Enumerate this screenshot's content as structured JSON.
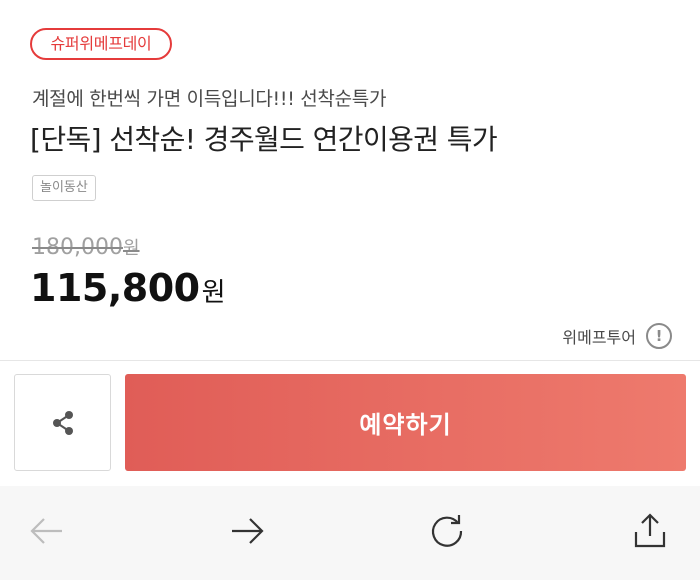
{
  "promo": {
    "badge": "슈퍼위메프데이"
  },
  "product": {
    "subtitle": "계절에 한번씩 가면 이득입니다!!! 선착순특가",
    "title": "[단독] 선착순! 경주월드 연간이용권 특가",
    "tag": "놀이동산",
    "original_price": "180,000",
    "original_unit": "원",
    "sale_price": "115,800",
    "sale_unit": "원",
    "seller": "위메프투어",
    "info_icon_text": "!"
  },
  "actions": {
    "share_icon": "share-icon",
    "reserve_label": "예약하기"
  },
  "browser": {
    "back_icon": "arrow-left-icon",
    "forward_icon": "arrow-right-icon",
    "reload_icon": "reload-icon",
    "share_icon": "upload-share-icon",
    "back_enabled": false
  },
  "colors": {
    "accent": "#e53b3b",
    "button_start": "#e05d57",
    "button_end": "#ee7a6d",
    "browser_bar": "#f7f7f7"
  }
}
